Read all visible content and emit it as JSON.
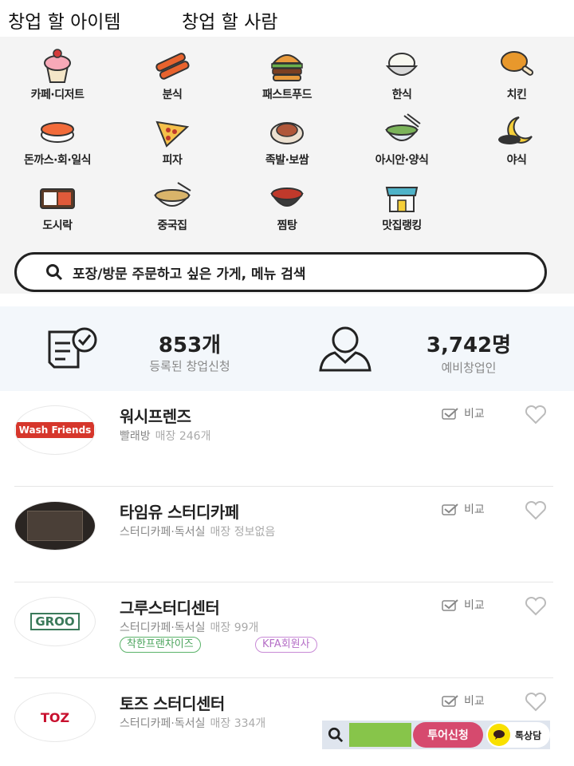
{
  "tabs": [
    "창업 할 아이템",
    "창업 할 사람"
  ],
  "categories": [
    {
      "label": "카페·디저트",
      "icon": "cupcake-icon"
    },
    {
      "label": "분식",
      "icon": "snack-icon"
    },
    {
      "label": "패스트푸드",
      "icon": "burger-icon"
    },
    {
      "label": "한식",
      "icon": "rice-bowl-icon"
    },
    {
      "label": "치킨",
      "icon": "chicken-icon"
    },
    {
      "label": "돈까스·회·일식",
      "icon": "sushi-icon"
    },
    {
      "label": "피자",
      "icon": "pizza-icon"
    },
    {
      "label": "족발·보쌈",
      "icon": "pork-icon"
    },
    {
      "label": "아시안·양식",
      "icon": "noodle-icon"
    },
    {
      "label": "야식",
      "icon": "moon-icon"
    },
    {
      "label": "도시락",
      "icon": "lunchbox-icon"
    },
    {
      "label": "중국집",
      "icon": "jajang-icon"
    },
    {
      "label": "찜탕",
      "icon": "stew-icon"
    },
    {
      "label": "맛집랭킹",
      "icon": "store-icon"
    }
  ],
  "search": {
    "placeholder": "포장/방문 주문하고 싶은 가게, 메뉴 검색"
  },
  "stats": [
    {
      "value": "853개",
      "label": "등록된 창업신청",
      "icon": "checklist-icon"
    },
    {
      "value": "3,742명",
      "label": "예비창업인",
      "icon": "person-icon"
    }
  ],
  "franchises": [
    {
      "name": "워시프렌즈",
      "category": "빨래방",
      "stores": "매장 246개",
      "logo": "Wash Friends",
      "tags": []
    },
    {
      "name": "타임유 스터디카페",
      "category": "스터디카페·독서실",
      "stores": "매장 정보없음",
      "logo": "",
      "tags": []
    },
    {
      "name": "그루스터디센터",
      "category": "스터디카페·독서실",
      "stores": "매장 99개",
      "logo": "GROO",
      "tags": [
        "착한프랜차이즈",
        "KFA회원사"
      ]
    },
    {
      "name": "토즈 스터디센터",
      "category": "스터디카페·독서실",
      "stores": "매장 334개",
      "logo": "TOZ",
      "tags": []
    }
  ],
  "compare_label": "비교",
  "floating": {
    "tour_label": "투어신청",
    "talk_label": "톡상담"
  },
  "colors": {
    "stats_bg": "#f3f7fb",
    "tag_green": "#4aa35b",
    "tag_purple": "#b56fc7",
    "talk_yellow": "#f9e000"
  }
}
